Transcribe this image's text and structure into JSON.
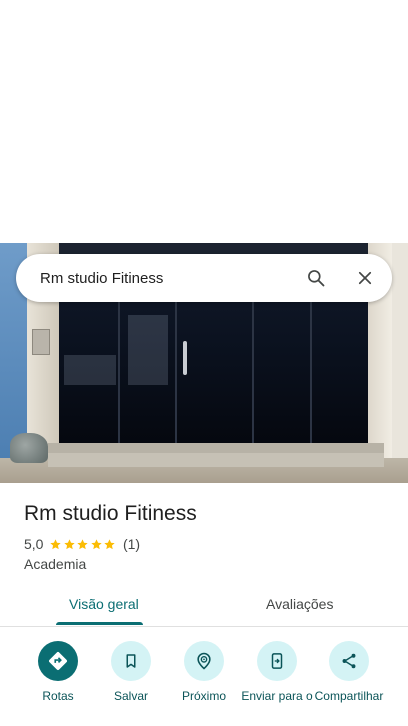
{
  "search": {
    "query": "Rm studio Fitiness",
    "search_icon": "search-icon",
    "close_icon": "close-icon"
  },
  "place": {
    "name": "Rm studio Fitiness",
    "rating": "5,0",
    "stars": 5,
    "review_count": "(1)",
    "category": "Academia"
  },
  "tabs": [
    {
      "label": "Visão geral",
      "active": true
    },
    {
      "label": "Avaliações",
      "active": false
    }
  ],
  "actions": [
    {
      "label": "Rotas",
      "icon": "directions-icon"
    },
    {
      "label": "Salvar",
      "icon": "bookmark-icon"
    },
    {
      "label": "Próximo",
      "icon": "nearby-icon"
    },
    {
      "label": "Enviar para o",
      "icon": "send-to-phone-icon"
    },
    {
      "label": "Compartilhar",
      "icon": "share-icon"
    }
  ],
  "colors": {
    "accent": "#0b6e73",
    "action_bg": "#d4f3f5",
    "star": "#fbbc04"
  }
}
